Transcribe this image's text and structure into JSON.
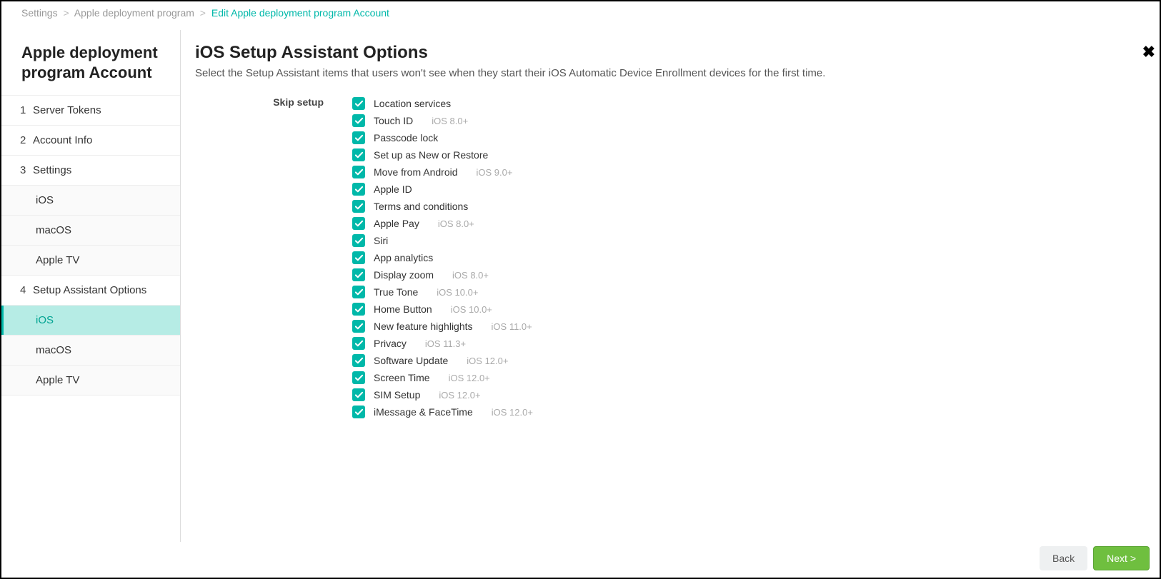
{
  "breadcrumb": {
    "items": [
      "Settings",
      "Apple deployment program",
      "Edit Apple deployment program Account"
    ]
  },
  "sidebar": {
    "title": "Apple deployment program Account",
    "items": [
      {
        "num": "1",
        "label": "Server Tokens",
        "type": "top"
      },
      {
        "num": "2",
        "label": "Account Info",
        "type": "top"
      },
      {
        "num": "3",
        "label": "Settings",
        "type": "top"
      },
      {
        "num": "",
        "label": "iOS",
        "type": "sub"
      },
      {
        "num": "",
        "label": "macOS",
        "type": "sub"
      },
      {
        "num": "",
        "label": "Apple TV",
        "type": "sub"
      },
      {
        "num": "4",
        "label": "Setup Assistant Options",
        "type": "top"
      },
      {
        "num": "",
        "label": "iOS",
        "type": "sub",
        "active": true
      },
      {
        "num": "",
        "label": "macOS",
        "type": "sub"
      },
      {
        "num": "",
        "label": "Apple TV",
        "type": "sub"
      }
    ]
  },
  "main": {
    "title": "iOS Setup Assistant Options",
    "subtitle": "Select the Setup Assistant items that users won't see when they start their iOS Automatic Device Enrollment devices for the first time.",
    "section_label": "Skip setup"
  },
  "options": [
    {
      "label": "Location services",
      "hint": ""
    },
    {
      "label": "Touch ID",
      "hint": "iOS 8.0+"
    },
    {
      "label": "Passcode lock",
      "hint": ""
    },
    {
      "label": "Set up as New or Restore",
      "hint": ""
    },
    {
      "label": "Move from Android",
      "hint": "iOS 9.0+"
    },
    {
      "label": "Apple ID",
      "hint": ""
    },
    {
      "label": "Terms and conditions",
      "hint": ""
    },
    {
      "label": "Apple Pay",
      "hint": "iOS 8.0+"
    },
    {
      "label": "Siri",
      "hint": ""
    },
    {
      "label": "App analytics",
      "hint": ""
    },
    {
      "label": "Display zoom",
      "hint": "iOS 8.0+"
    },
    {
      "label": "True Tone",
      "hint": "iOS 10.0+"
    },
    {
      "label": "Home Button",
      "hint": "iOS 10.0+"
    },
    {
      "label": "New feature highlights",
      "hint": "iOS 11.0+"
    },
    {
      "label": "Privacy",
      "hint": "iOS 11.3+"
    },
    {
      "label": "Software Update",
      "hint": "iOS 12.0+"
    },
    {
      "label": "Screen Time",
      "hint": "iOS 12.0+"
    },
    {
      "label": "SIM Setup",
      "hint": "iOS 12.0+"
    },
    {
      "label": "iMessage & FaceTime",
      "hint": "iOS 12.0+"
    }
  ],
  "footer": {
    "back": "Back",
    "next": "Next >"
  }
}
